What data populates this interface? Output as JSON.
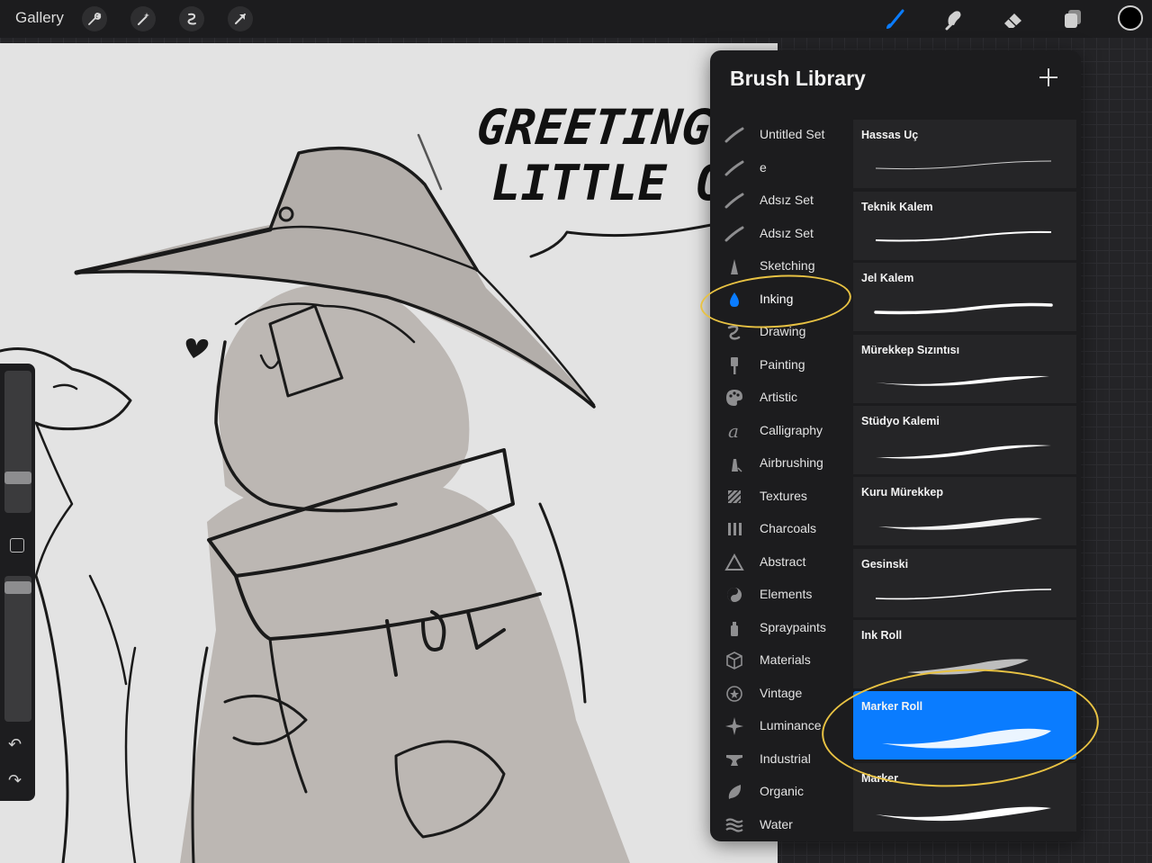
{
  "topbar": {
    "gallery_label": "Gallery",
    "left_tools": [
      "wrench-icon",
      "magic-wand-icon",
      "selection-icon",
      "transform-arrow-icon"
    ],
    "right_tools": [
      "brush-icon",
      "smudge-icon",
      "eraser-icon",
      "layers-icon"
    ],
    "accent": "#0a7cff",
    "current_color": "#000000"
  },
  "canvas": {
    "lettering": "GREETING LITTLE ON",
    "background": "#e3e3e3"
  },
  "sidebar": {
    "size_slider_level": 0.36,
    "opacity_slider_level": 0.92
  },
  "panel": {
    "title": "Brush Library",
    "add_button": "+",
    "active_set": "Inking",
    "sets": [
      {
        "label": "Untitled Set",
        "icon": "set-stroke-icon"
      },
      {
        "label": "e",
        "icon": "set-stroke-icon"
      },
      {
        "label": "Adsız Set",
        "icon": "set-stroke-icon"
      },
      {
        "label": "Adsız Set",
        "icon": "set-stroke-icon"
      },
      {
        "label": "Sketching",
        "icon": "pencil-icon"
      },
      {
        "label": "Inking",
        "icon": "ink-drop-icon"
      },
      {
        "label": "Drawing",
        "icon": "squiggle-icon"
      },
      {
        "label": "Painting",
        "icon": "paintbrush-icon"
      },
      {
        "label": "Artistic",
        "icon": "palette-icon"
      },
      {
        "label": "Calligraphy",
        "icon": "calligraphy-icon"
      },
      {
        "label": "Airbrushing",
        "icon": "airbrush-icon"
      },
      {
        "label": "Textures",
        "icon": "texture-icon"
      },
      {
        "label": "Charcoals",
        "icon": "charcoal-icon"
      },
      {
        "label": "Abstract",
        "icon": "triangle-icon"
      },
      {
        "label": "Elements",
        "icon": "yin-yang-icon"
      },
      {
        "label": "Spraypaints",
        "icon": "spraycan-icon"
      },
      {
        "label": "Materials",
        "icon": "cube-icon"
      },
      {
        "label": "Vintage",
        "icon": "star-badge-icon"
      },
      {
        "label": "Luminance",
        "icon": "sparkle-icon"
      },
      {
        "label": "Industrial",
        "icon": "anvil-icon"
      },
      {
        "label": "Organic",
        "icon": "leaf-icon"
      },
      {
        "label": "Water",
        "icon": "waves-icon"
      }
    ],
    "selected_brush": "Marker Roll",
    "brushes": [
      {
        "name": "Hassas Uç",
        "stroke": "fine"
      },
      {
        "name": "Teknik Kalem",
        "stroke": "technical"
      },
      {
        "name": "Jel Kalem",
        "stroke": "gel"
      },
      {
        "name": "Mürekkep Sızıntısı",
        "stroke": "bleed"
      },
      {
        "name": "Stüdyo Kalemi",
        "stroke": "studio"
      },
      {
        "name": "Kuru Mürekkep",
        "stroke": "dry"
      },
      {
        "name": "Gesinski",
        "stroke": "gesinski"
      },
      {
        "name": "Ink Roll",
        "stroke": "roll"
      },
      {
        "name": "Marker Roll",
        "stroke": "marker-roll"
      },
      {
        "name": "Marker",
        "stroke": "marker"
      }
    ]
  }
}
